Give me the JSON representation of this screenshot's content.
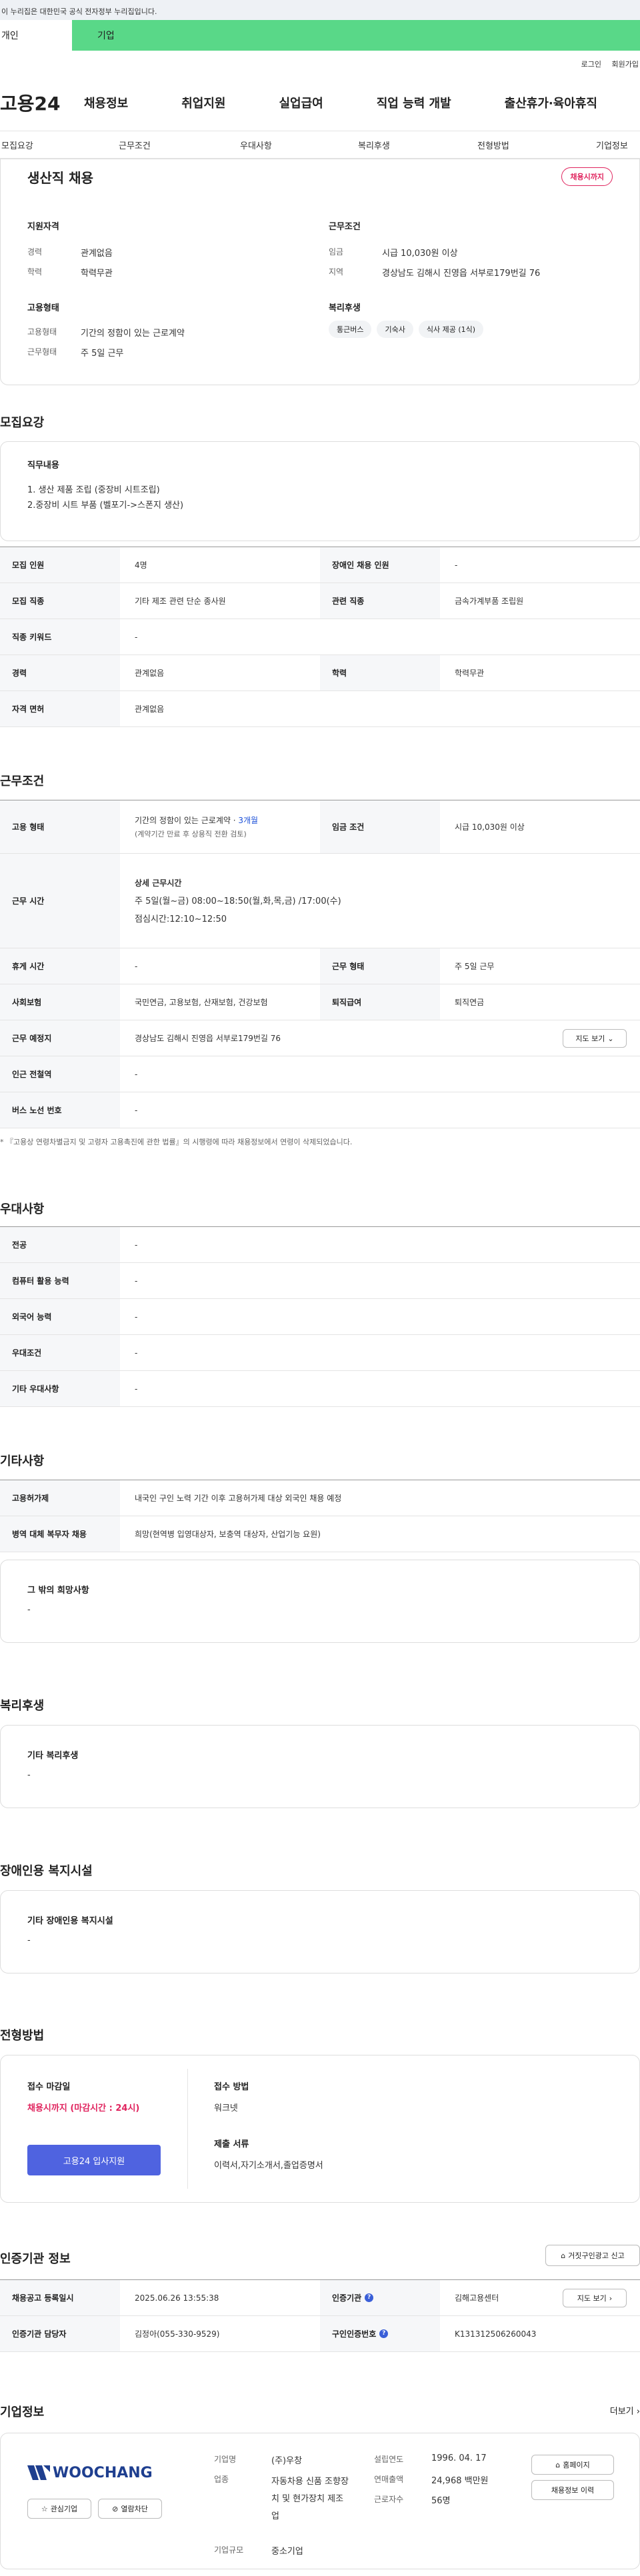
{
  "gov_notice": "이 누리집은 대한민국 공식 전자정부 누리집입니다.",
  "top_tabs": [
    "개인",
    "기업"
  ],
  "util": [
    "로그인",
    "회원가입"
  ],
  "logo": "고용24",
  "gnb": [
    "채용정보",
    "취업지원",
    "실업급여",
    "직업 능력 개발",
    "출산휴가·육아휴직"
  ],
  "subnav": [
    "모집요강",
    "근무조건",
    "우대사항",
    "복리후생",
    "전형방법",
    "기업정보"
  ],
  "summary": {
    "title": "생산직 채용",
    "status": "채용시까지",
    "qual_h": "지원자격",
    "career_l": "경력",
    "career_v": "관계없음",
    "edu_l": "학력",
    "edu_v": "학력무관",
    "emp_h": "고용형태",
    "emptype_l": "고용형태",
    "emptype_v": "기간의 정함이 있는 근로계약",
    "work_l": "근무형태",
    "work_v": "주 5일 근무",
    "cond_h": "근무조건",
    "wage_l": "임금",
    "wage_v": "시급 10,030원 이상",
    "region_l": "지역",
    "region_v": "경상남도 김해시 진영읍 서부로179번길 76",
    "welfare_h": "복리후생",
    "chips": [
      "통근버스",
      "기숙사",
      "식사 제공 (1식)"
    ]
  },
  "recruit": {
    "h": "모집요강",
    "duty_h": "직무내용",
    "duty1": "1. 생산 제품 조립 (중장비 시트조립)",
    "duty2": "2.중장비 시트 부품 (벨포기->스폰지 생산)",
    "rows": [
      [
        "모집 인원",
        "4명",
        "장애인 채용 인원",
        "-"
      ],
      [
        "모집 직종",
        "기타 제조 관련 단순 종사원",
        "관련 직종",
        "금속가계부품 조립원"
      ],
      [
        "직종 키워드",
        "-"
      ],
      [
        "경력",
        "관계없음",
        "학력",
        "학력무관"
      ],
      [
        "자격 면허",
        "관계없음"
      ]
    ]
  },
  "workcond": {
    "h": "근무조건",
    "emp_l": "고용 형태",
    "emp_v1": "기간의 정함이 있는 근로계약 · ",
    "emp_v1b": "3개월",
    "emp_v2": "(계약기간 만료 후 상용직 전환 검토)",
    "wage_l": "임금 조건",
    "wage_v": "시급 10,030원 이상",
    "time_l": "근무 시간",
    "time_h": "상세 근무시간",
    "time_v1": "주 5일(월~금) 08:00~18:50(월,화,목,금) /17:00(수)",
    "time_v2": "점심시간:12:10~12:50",
    "rows": [
      [
        "휴게 시간",
        "-",
        "근무 형태",
        "주 5일 근무"
      ],
      [
        "사회보험",
        "국민연금, 고용보험, 산재보험, 건강보험",
        "퇴직급여",
        "퇴직연금"
      ],
      [
        "근무 예정지",
        "경상남도 김해시 진영읍 서부로179번길 76"
      ],
      [
        "인근 전철역",
        "-"
      ],
      [
        "버스 노선 번호",
        "-"
      ]
    ],
    "map_btn": "지도 보기",
    "note": "* 『고용상 연령차별금지 및 고령자 고용촉진에 관한 법률』의 시행령에 따라 채용정보에서 연령이 삭제되었습니다."
  },
  "pref": {
    "h": "우대사항",
    "rows": [
      [
        "전공",
        "-"
      ],
      [
        "컴퓨터 활용 능력",
        "-"
      ],
      [
        "외국어 능력",
        "-"
      ],
      [
        "우대조건",
        "-"
      ],
      [
        "기타 우대사항",
        "-"
      ]
    ]
  },
  "etc": {
    "h": "기타사항",
    "rows": [
      [
        "고용허가제",
        "내국인 구인 노력 기간 이후 고용허가제 대상 외국인 채용 예정"
      ],
      [
        "병역 대체 복무자 채용",
        "희망(현역병 입영대상자, 보충역 대상자, 산업기능 요원)"
      ]
    ],
    "other_h": "그 밖의 희망사항",
    "other_v": "-"
  },
  "welfare": {
    "h": "복리후생",
    "sub": "기타 복리후생",
    "v": "-"
  },
  "disab": {
    "h": "장애인용 복지시설",
    "sub": "기타 장애인용 복지시설",
    "v": "-"
  },
  "process": {
    "h": "전형방법",
    "deadline_l": "접수 마감일",
    "deadline_v": "채용시까지 (마감시간 : 24시)",
    "apply_btn": "고용24 입사지원",
    "method_l": "접수 방법",
    "method_v": "워크넷",
    "docs_l": "제출 서류",
    "docs_v": "이력서,자기소개서,졸업증명서"
  },
  "agency": {
    "h": "인증기관 정보",
    "report_btn": "거짓구인광고 신고",
    "r1": [
      "채용공고 등록일시",
      "2025.06.26 13:55:38",
      "인증기관",
      "김해고용센터"
    ],
    "r2": [
      "인증기관 담당자",
      "김정아(055-330-9529)",
      "구인인증번호",
      "K131312506260043"
    ],
    "map_btn": "지도 보기"
  },
  "company": {
    "h": "기업정보",
    "more": "더보기",
    "logo": "WOOCHANG",
    "fav": "관심기업",
    "block": "열람차단",
    "name_l": "기업명",
    "name_v": "(주)우창",
    "ind_l": "업종",
    "ind_v": "자동차용 신품 조향장치 및 현가장치 제조업",
    "size_l": "기업규모",
    "size_v": "중소기업",
    "est_l": "설립연도",
    "est_v": "1996. 04. 17",
    "sales_l": "연매출액",
    "sales_v": "24,968 백만원",
    "emp_l": "근로자수",
    "emp_v": "56명",
    "home_btn": "홈페이지",
    "hist_btn": "채용정보 이력"
  }
}
